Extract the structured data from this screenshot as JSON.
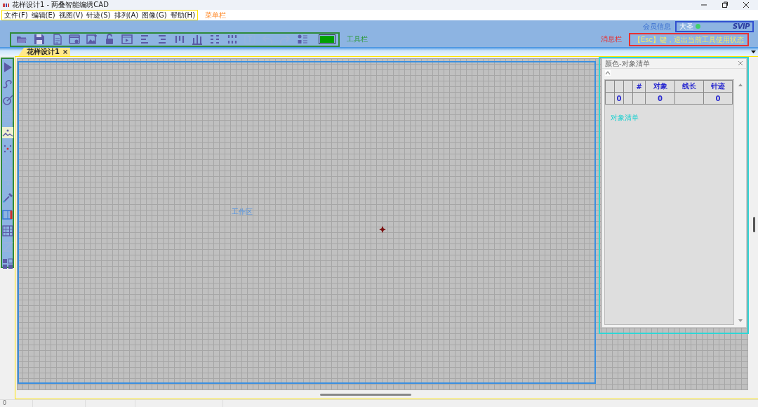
{
  "window": {
    "title": "花样设计1 - 两叠智能编绣CAD"
  },
  "menu": [
    {
      "label": "文件(F)"
    },
    {
      "label": "编辑(E)"
    },
    {
      "label": "视图(V)"
    },
    {
      "label": "针迹(S)"
    },
    {
      "label": "排列(A)"
    },
    {
      "label": "图像(G)"
    },
    {
      "label": "帮助(H)"
    }
  ],
  "annotations": {
    "menu": "菜单栏",
    "toolbar": "工具栏",
    "member": "会员信息",
    "message": "消息栏",
    "workspace": "工作区",
    "objects": "对象清单"
  },
  "member": {
    "name": "大圣",
    "online": true,
    "badge": "SVIP"
  },
  "message": "【Esc】键，退出当前工具使用状态",
  "toolbar": [
    {
      "kind": "open",
      "disabled": false
    },
    {
      "kind": "save",
      "disabled": false
    },
    {
      "kind": "copy",
      "disabled": false
    },
    {
      "kind": "window",
      "disabled": false
    },
    {
      "kind": "image",
      "disabled": false
    },
    {
      "kind": "lock",
      "disabled": false
    },
    {
      "kind": "play",
      "disabled": false
    },
    {
      "kind": "align-left",
      "disabled": false
    },
    {
      "kind": "align-right",
      "disabled": false
    },
    {
      "kind": "align-top",
      "disabled": false
    },
    {
      "kind": "align-bottom",
      "disabled": false
    },
    {
      "kind": "spread-h",
      "disabled": false
    },
    {
      "kind": "spread-v",
      "disabled": false
    },
    {
      "kind": "text",
      "disabled": true
    },
    {
      "kind": "undo",
      "disabled": true
    },
    {
      "kind": "redo",
      "disabled": true
    },
    {
      "kind": "list",
      "disabled": false
    },
    {
      "kind": "color",
      "color": "#00a000"
    }
  ],
  "tabs": [
    {
      "label": "花样设计1",
      "selected": true
    }
  ],
  "tools": [
    {
      "kind": "pointer",
      "disabled": false
    },
    {
      "kind": "curve",
      "disabled": false
    },
    {
      "kind": "needle",
      "disabled": false
    },
    {
      "kind": "form",
      "disabled": true
    },
    {
      "kind": "picture",
      "disabled": false
    },
    {
      "kind": "points",
      "disabled": false
    },
    {
      "kind": "corner",
      "disabled": true
    },
    {
      "kind": "cut",
      "disabled": true
    },
    {
      "kind": "dropper",
      "disabled": false
    },
    {
      "kind": "split",
      "disabled": false
    },
    {
      "kind": "grid",
      "disabled": false
    },
    {
      "kind": "zigzag",
      "disabled": true
    },
    {
      "kind": "blocks",
      "disabled": false
    }
  ],
  "panel": {
    "title": "颜色-对象清单",
    "columns": [
      {},
      {},
      {},
      {
        "label": "#"
      },
      {
        "label": "对象"
      },
      {
        "label": "线长"
      },
      {
        "label": "针迹"
      }
    ],
    "rows": [
      [
        {},
        {
          "value": "0"
        },
        {},
        {},
        {
          "value": "0"
        },
        {},
        {
          "value": "0"
        }
      ]
    ]
  },
  "status_bar": {
    "cells": [
      {
        "value": "0"
      },
      {},
      {},
      {}
    ]
  }
}
